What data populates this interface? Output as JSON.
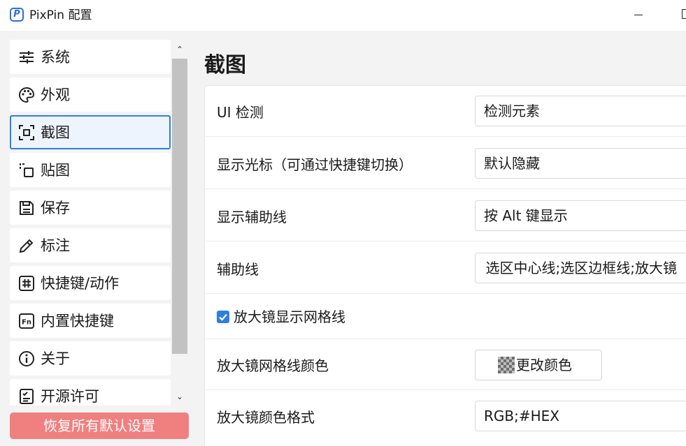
{
  "window": {
    "title": "PixPin 配置",
    "logo_letter": "P"
  },
  "sidebar": {
    "items": [
      {
        "label": "系统",
        "icon": "sliders-icon"
      },
      {
        "label": "外观",
        "icon": "palette-icon"
      },
      {
        "label": "截图",
        "icon": "screenshot-frame-icon",
        "selected": true
      },
      {
        "label": "贴图",
        "icon": "pin-copy-icon"
      },
      {
        "label": "保存",
        "icon": "save-icon"
      },
      {
        "label": "标注",
        "icon": "pencil-icon"
      },
      {
        "label": "快捷键/动作",
        "icon": "hashtag-icon"
      },
      {
        "label": "内置快捷键",
        "icon": "fn-key-icon"
      },
      {
        "label": "关于",
        "icon": "info-icon"
      },
      {
        "label": "开源许可",
        "icon": "license-check-icon"
      }
    ],
    "reset_label": "恢复所有默认设置"
  },
  "main": {
    "title": "截图",
    "settings": {
      "ui_detect": {
        "label": "UI 检测",
        "value": "检测元素"
      },
      "show_cursor": {
        "label": "显示光标（可通过快捷键切换）",
        "value": "默认隐藏"
      },
      "show_guides": {
        "label": "显示辅助线",
        "value": "按 Alt 键显示"
      },
      "guides": {
        "label": "辅助线",
        "value": "选区中心线;选区边框线;放大镜"
      },
      "magnifier_grid": {
        "label": "放大镜显示网格线",
        "checked": true
      },
      "grid_color": {
        "label": "放大镜网格线颜色",
        "button_label": "更改颜色"
      },
      "color_format": {
        "label": "放大镜颜色格式",
        "value": "RGB;#HEX"
      }
    }
  },
  "colors": {
    "accent": "#2f7fe0",
    "reset_button": "#f07f7f",
    "background": "#f3f3f3"
  }
}
